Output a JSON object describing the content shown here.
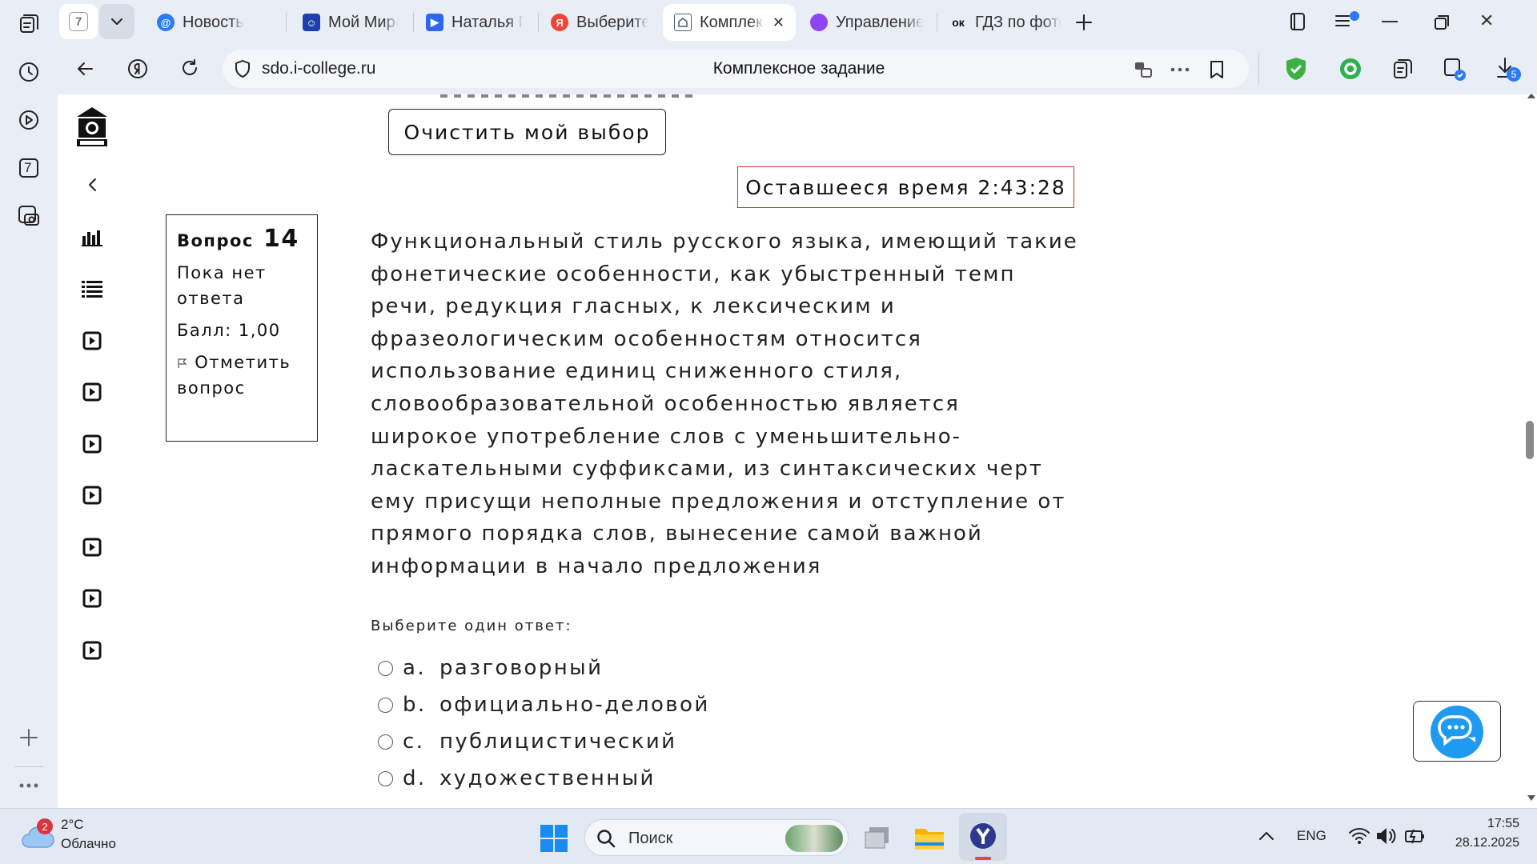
{
  "browser": {
    "tab_counter": "7",
    "tabs": [
      {
        "label": "Новость",
        "icon": "mail-at-icon",
        "color": "#2a7bf5"
      },
      {
        "label": "Мой Мир@Mail.ru",
        "icon": "moymir-icon",
        "color": "#1e3fae"
      },
      {
        "label": "Наталья Гранд",
        "icon": "play-video-icon",
        "color": "#2f66f0"
      },
      {
        "label": "Выберите одно",
        "icon": "yandex-icon",
        "color": "#f33"
      },
      {
        "label": "Комплексное",
        "icon": "college-logo-icon",
        "color": "#4b5b77"
      },
      {
        "label": "Управление",
        "icon": "purple-drop-icon",
        "color": "#8b45f5"
      },
      {
        "label": "ГДЗ по фото",
        "icon": "ok-icon",
        "color": "#111"
      }
    ],
    "address": "sdo.i-college.ru",
    "page_title": "Комплексное задание",
    "downloads_badge": "5",
    "rail_counter": "7"
  },
  "page": {
    "clear_choice": "Очистить мой выбор",
    "timer": "Оставшееся время 2:43:28",
    "question_info": {
      "label": "Вопрос",
      "number": "14",
      "status_line1": "Пока нет",
      "status_line2": "ответа",
      "score": "Балл: 1,00",
      "flag_line1": "Отметить",
      "flag_line2": "вопрос"
    },
    "question_lines": [
      "Функциональный стиль русского языка, имеющий такие",
      "фонетические особенности, как убыстренный темп",
      "речи, редукция гласных, к лексическим и",
      "фразеологическим особенностям относится",
      "использование единиц сниженного стиля,",
      "словообразовательной особенностью является",
      "широкое употребление слов с уменьшительно-",
      "ласкательными суффиксами, из синтаксических черт",
      "ему присущи неполные предложения и отступление от",
      "прямого порядка слов, вынесение самой важной",
      "информации в начало предложения"
    ],
    "prompt": "Выберите один ответ:",
    "options": [
      {
        "letter": "a.",
        "text": "разговорный"
      },
      {
        "letter": "b.",
        "text": "официально-деловой"
      },
      {
        "letter": "c.",
        "text": "публицистический"
      },
      {
        "letter": "d.",
        "text": "художественный"
      }
    ]
  },
  "taskbar": {
    "weather_temp": "2°C",
    "weather_desc": "Облачно",
    "weather_badge": "2",
    "search_placeholder": "Поиск",
    "lang": "ENG",
    "time": "17:55",
    "date": "28.12.2025"
  }
}
